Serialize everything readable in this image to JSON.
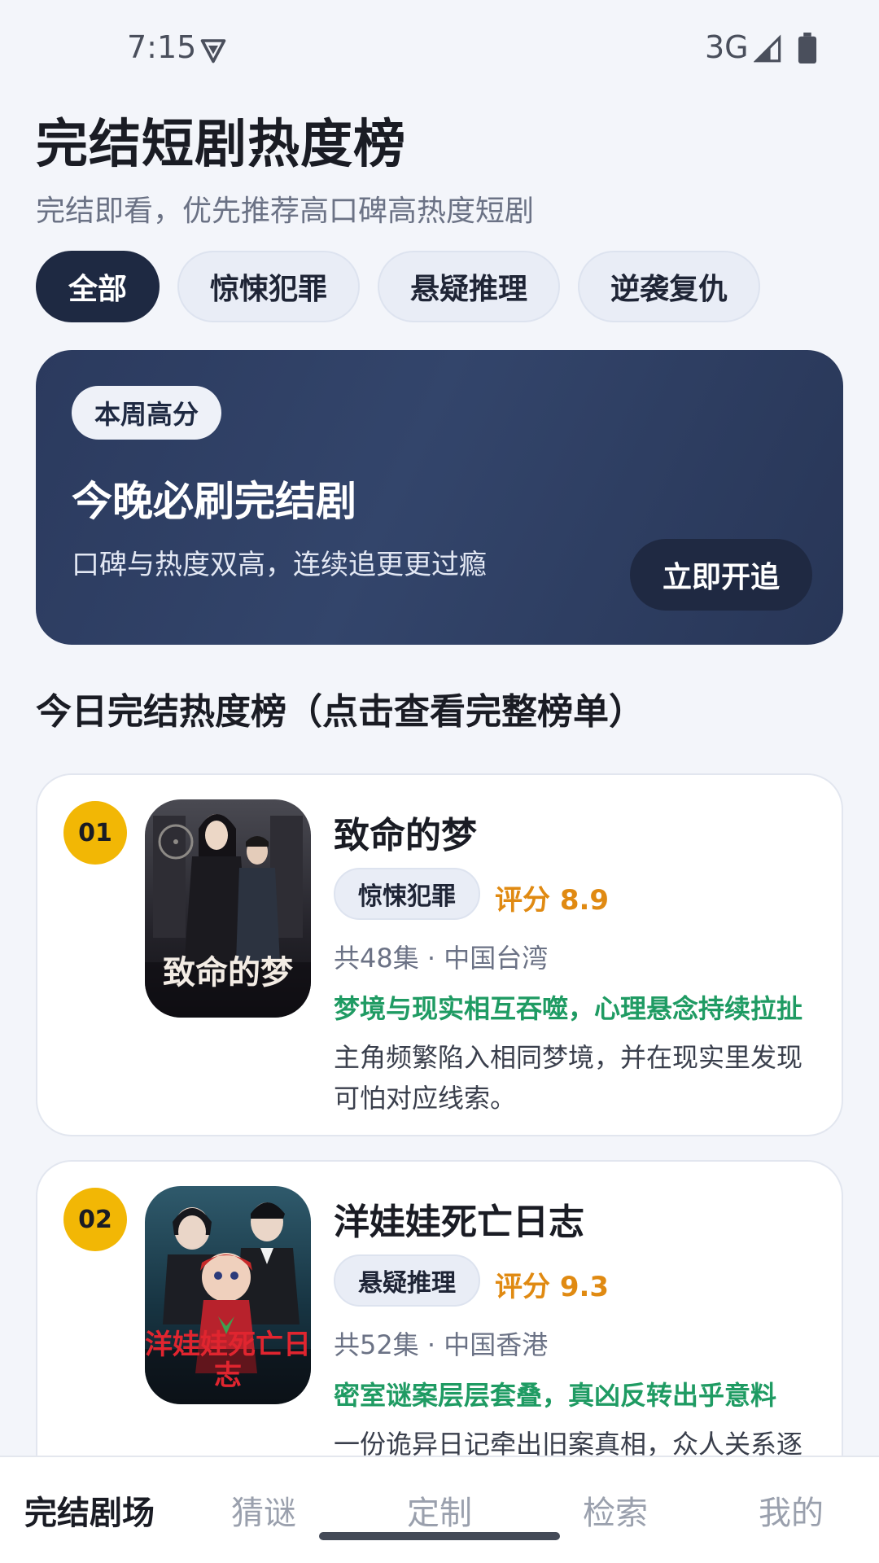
{
  "status_bar": {
    "time": "7:15",
    "network": "3G",
    "icons": [
      "vpn-icon",
      "signal-icon",
      "battery-icon"
    ]
  },
  "header": {
    "title": "完结短剧热度榜",
    "subtitle": "完结即看，优先推荐高口碑高热度短剧"
  },
  "chips": [
    {
      "label": "全部",
      "active": true
    },
    {
      "label": "惊悚犯罪",
      "active": false
    },
    {
      "label": "悬疑推理",
      "active": false
    },
    {
      "label": "逆袭复仇",
      "active": false
    }
  ],
  "banner": {
    "badge": "本周高分",
    "title": "今晚必刷完结剧",
    "desc": "口碑与热度双高，连续追更更过瘾",
    "button": "立即开追"
  },
  "section_title": "今日完结热度榜（点击查看完整榜单）",
  "dramas": [
    {
      "rank": "01",
      "name": "致命的梦",
      "poster_text": "致命的梦",
      "genre": "惊悚犯罪",
      "score": "评分 8.9",
      "meta": "共48集 · 中国台湾",
      "highlight": "梦境与现实相互吞噬，心理悬念持续拉扯",
      "desc": "主角频繁陷入相同梦境，并在现实里发现可怕对应线索。"
    },
    {
      "rank": "02",
      "name": "洋娃娃死亡日志",
      "poster_text": "洋娃娃死亡日志",
      "genre": "悬疑推理",
      "score": "评分 9.3",
      "meta": "共52集 · 中国香港",
      "highlight": "密室谜案层层套叠，真凶反转出乎意料",
      "desc": "一份诡异日记牵出旧案真相，众人关系逐"
    }
  ],
  "colors": {
    "accent": "#1e2942",
    "rank": "#f2b705",
    "score": "#e08a12",
    "highlight": "#1f9b63"
  },
  "bottom_nav": [
    {
      "label": "完结剧场",
      "active": true
    },
    {
      "label": "猜谜",
      "active": false
    },
    {
      "label": "定制",
      "active": false
    },
    {
      "label": "检索",
      "active": false
    },
    {
      "label": "我的",
      "active": false
    }
  ]
}
